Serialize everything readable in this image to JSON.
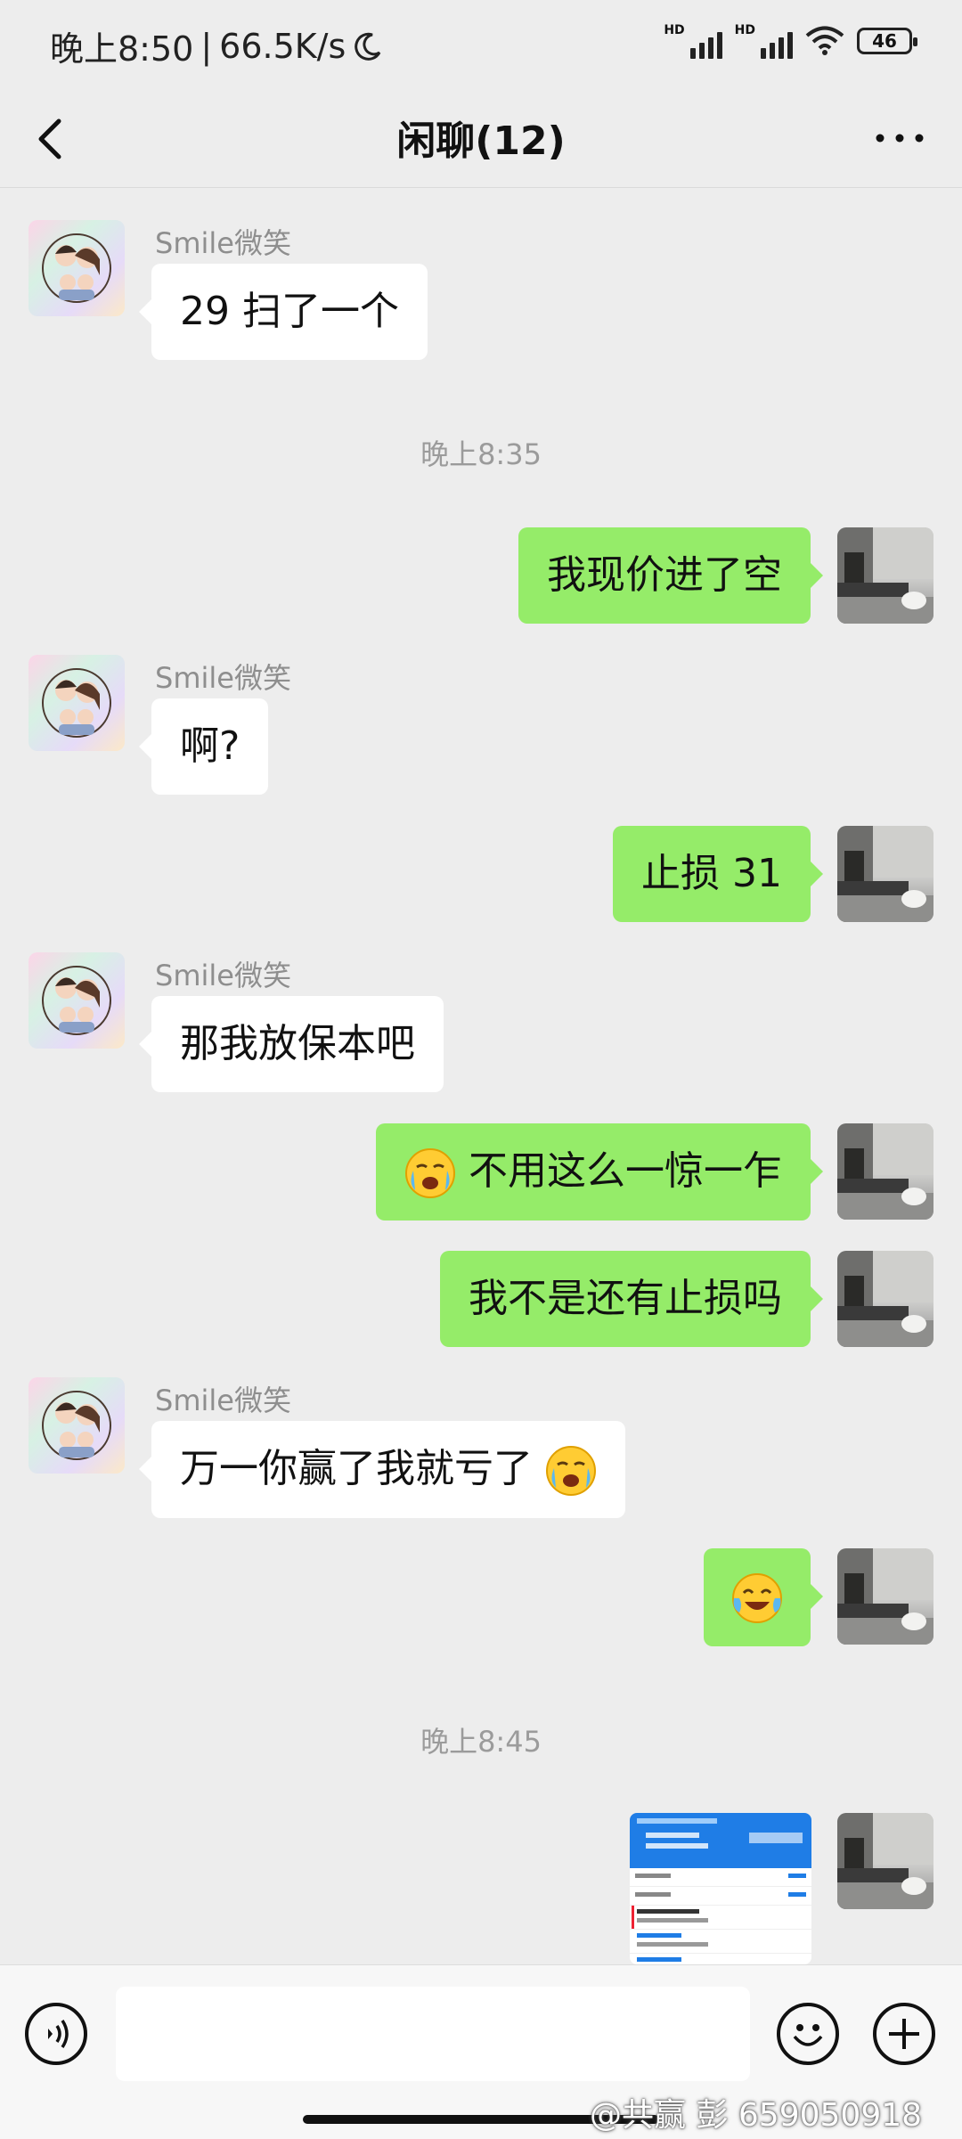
{
  "status_bar": {
    "time": "晚上8:50",
    "net_speed": "66.5K/s",
    "battery": "46",
    "hd_label": "HD"
  },
  "nav": {
    "title": "闲聊(12)"
  },
  "messages": {
    "m1": {
      "sender": "Smile微笑",
      "text": "29 扫了一个"
    },
    "time1": "晚上8:35",
    "m2": {
      "text": "我现价进了空"
    },
    "m3": {
      "sender": "Smile微笑",
      "text": "啊?"
    },
    "m4": {
      "text": "止损 31"
    },
    "m5": {
      "sender": "Smile微笑",
      "text": "那我放保本吧"
    },
    "m6": {
      "text": "不用这么一惊一乍"
    },
    "m7": {
      "text": "我不是还有止损吗"
    },
    "m8": {
      "sender": "Smile微笑",
      "text": "万一你赢了我就亏了"
    },
    "m9": {
      "emoji": "laughing-with-tears"
    },
    "time2": "晚上8:45",
    "m10": {
      "type": "image",
      "description": "trading-app-screenshot"
    }
  },
  "watermark": "@共赢 彭 659050918",
  "colors": {
    "background": "#EDEDED",
    "outgoing_bubble": "#95EC69",
    "incoming_bubble": "#FFFFFF",
    "input_bar": "#F7F7F7"
  }
}
